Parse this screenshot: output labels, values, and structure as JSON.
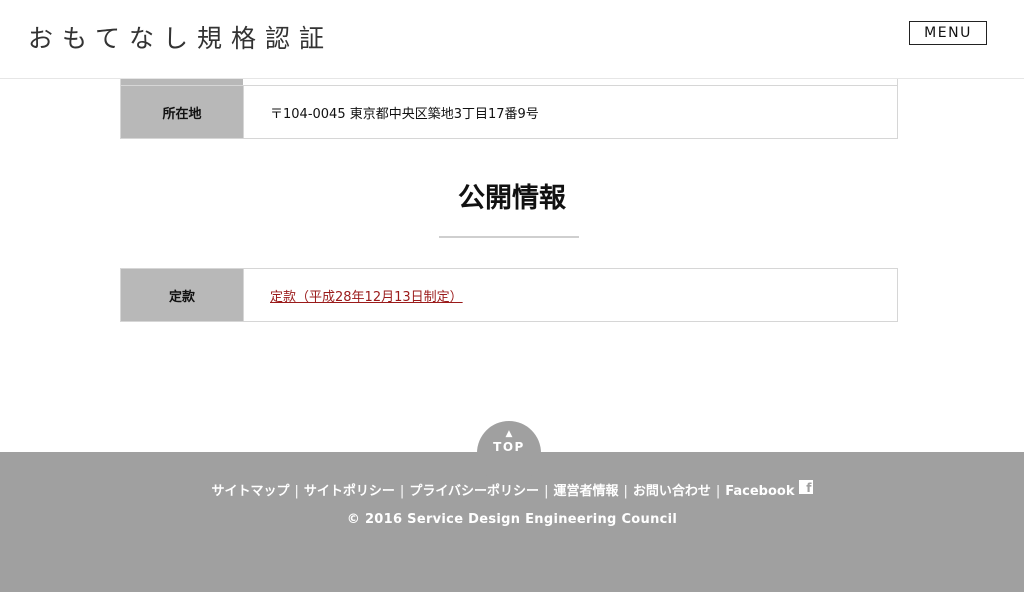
{
  "header": {
    "logo_text": "おもてなし規格認証",
    "menu_label": "MENU"
  },
  "company_info": {
    "address_label": "所在地",
    "address_value": "〒104-0045 東京都中央区築地3丁目17番9号"
  },
  "disclosure": {
    "title": "公開情報",
    "rows": [
      {
        "label": "定款",
        "link_text": "定款（平成28年12月13日制定）"
      }
    ]
  },
  "top_button": {
    "arrow": "▲",
    "label": "TOP"
  },
  "footer": {
    "links": [
      "サイトマップ",
      "サイトポリシー",
      "プライバシーポリシー",
      "運営者情報",
      "お問い合わせ",
      "Facebook"
    ],
    "separator": "|",
    "facebook_icon": "f",
    "copyright": "© 2016 Service Design Engineering Council"
  },
  "colors": {
    "header_bg": "#ffffff",
    "label_cell_bg": "#b8b8b8",
    "link_color": "#9a1a1a",
    "footer_bg": "#a0a0a0",
    "footer_text": "#ffffff"
  }
}
